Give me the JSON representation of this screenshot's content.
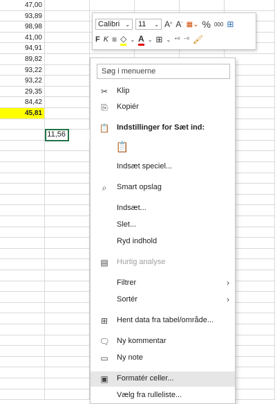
{
  "sheet": {
    "values": [
      "47,00",
      "93,89",
      "98,98",
      "41,00",
      "94,91",
      "89,82",
      "93,22",
      "93,22",
      "29,35",
      "84,42",
      "45,81"
    ],
    "active_cell_value": "11,56"
  },
  "minibar": {
    "font_name": "Calibri",
    "font_size": "11",
    "bold": "F",
    "italic": "K",
    "percent": "%",
    "thousands": "000"
  },
  "menu": {
    "search_placeholder": "Søg i menuerne",
    "items": [
      {
        "label": "Klip",
        "icon": "scissors-icon"
      },
      {
        "label": "Kopiér",
        "icon": "copy-icon"
      },
      {
        "label": "Indstillinger for Sæt ind:",
        "icon": "paste-icon"
      },
      {
        "label": "Indsæt speciel..."
      },
      {
        "label": "Smart opslag",
        "icon": "search-icon"
      },
      {
        "label": "Indsæt..."
      },
      {
        "label": "Slet..."
      },
      {
        "label": "Ryd indhold"
      },
      {
        "label": "Hurtig analyse",
        "icon": "quick-analysis-icon"
      },
      {
        "label": "Filtrer"
      },
      {
        "label": "Sortér"
      },
      {
        "label": "Hent data fra tabel/område...",
        "icon": "table-icon"
      },
      {
        "label": "Ny kommentar",
        "icon": "comment-icon"
      },
      {
        "label": "Ny note",
        "icon": "note-icon"
      },
      {
        "label": "Formatér celler...",
        "icon": "format-cells-icon"
      },
      {
        "label": "Vælg fra rulleliste..."
      }
    ]
  }
}
